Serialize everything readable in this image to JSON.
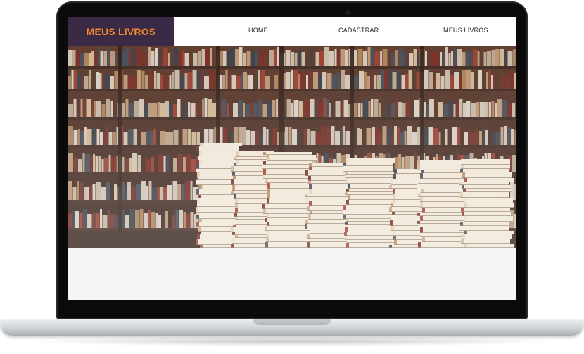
{
  "header": {
    "brand": "MEUS LIVROS"
  },
  "nav": {
    "items": [
      {
        "label": "HOME"
      },
      {
        "label": "CADASTRAR"
      },
      {
        "label": "MEUS LIVROS"
      }
    ]
  },
  "hero": {
    "image": "bookstore-shelves-and-book-stacks"
  },
  "colors": {
    "brand_bg": "#3a2a46",
    "brand_text": "#f18a2b",
    "nav_bg": "#ffffff",
    "content_bg": "#f3f5f6",
    "laptop_bezel": "#0b0b0c"
  }
}
